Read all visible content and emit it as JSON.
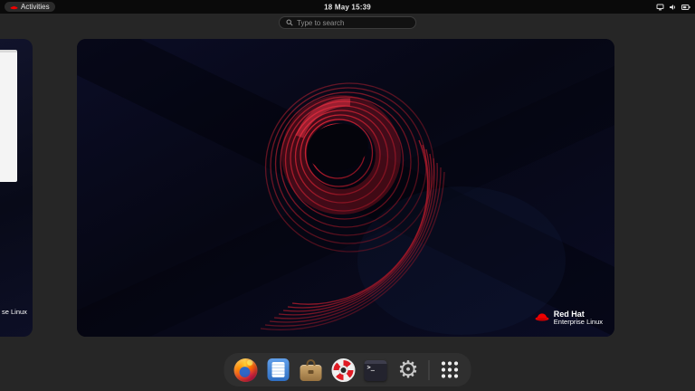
{
  "top_bar": {
    "activities_label": "Activities",
    "clock": "18 May 15:39",
    "status_icons": [
      "network",
      "volume",
      "battery"
    ]
  },
  "search": {
    "placeholder": "Type to search"
  },
  "workspace_preview": {
    "wallpaper": {
      "numeral": "9",
      "background_color": "#060714",
      "accent_color": "#e4202c"
    },
    "logo": {
      "title": "Red Hat",
      "subtitle": "Enterprise Linux"
    }
  },
  "adjacent_workspace": {
    "visible_text": "se Linux"
  },
  "dash": {
    "apps": [
      "firefox",
      "files",
      "software",
      "help",
      "terminal",
      "settings"
    ],
    "show_apps": "show-apps"
  }
}
